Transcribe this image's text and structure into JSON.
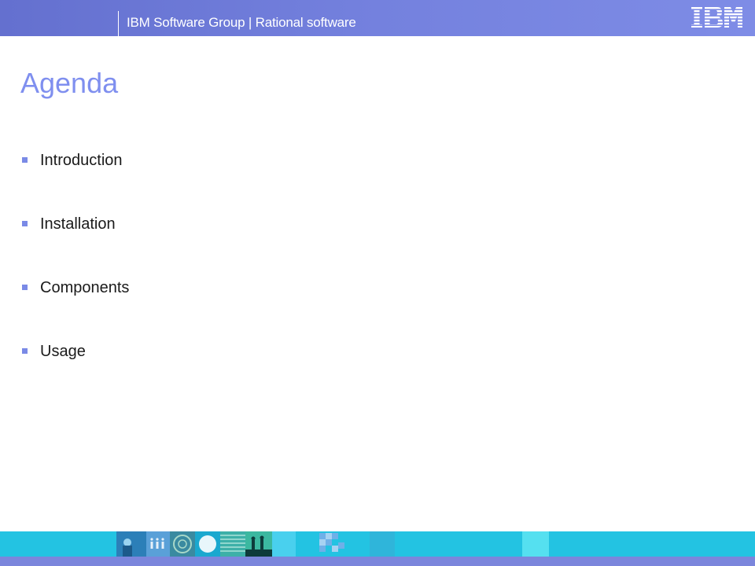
{
  "header": {
    "group_label": "IBM Software Group | Rational software",
    "logo_text": "IBM",
    "logo_icon": "ibm-logo-icon"
  },
  "slide": {
    "title": "Agenda",
    "items": [
      {
        "label": "Introduction"
      },
      {
        "label": "Installation"
      },
      {
        "label": "Components"
      },
      {
        "label": "Usage"
      }
    ]
  },
  "colors": {
    "header_bar": "#7481de",
    "title": "#7f8fef",
    "bullet": "#7a8ae6",
    "footer_strip": "#23c3e2",
    "footer_bottom": "#7b86dc"
  },
  "footer": {
    "image_icon": "decorative-image-strip"
  }
}
